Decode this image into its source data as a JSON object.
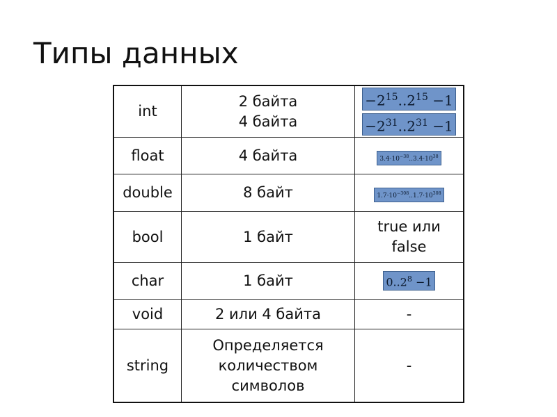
{
  "title": "Типы данных",
  "rows": [
    {
      "type": "int",
      "size": [
        "2 байта",
        "4 байта"
      ],
      "range": [
        [
          {
            "t": "−2"
          },
          {
            "s": "15"
          },
          {
            "t": "..2"
          },
          {
            "s": "15"
          },
          {
            "t": " −1"
          }
        ],
        [
          {
            "t": "−2"
          },
          {
            "s": "31"
          },
          {
            "t": "..2"
          },
          {
            "s": "31"
          },
          {
            "t": " −1"
          }
        ]
      ]
    },
    {
      "type": "float",
      "size": [
        "4 байта"
      ],
      "range": [
        [
          {
            "t": "3.4·10"
          },
          {
            "s": "−38"
          },
          {
            "t": "..3.4·10"
          },
          {
            "s": "38"
          }
        ]
      ]
    },
    {
      "type": "double",
      "size": [
        "8 байт"
      ],
      "range": [
        [
          {
            "t": "1.7·10"
          },
          {
            "s": "−308"
          },
          {
            "t": "..1.7·10"
          },
          {
            "s": "308"
          }
        ]
      ]
    },
    {
      "type": "bool",
      "size": [
        "1 байт"
      ],
      "range_text": [
        "true или",
        "false"
      ]
    },
    {
      "type": "char",
      "size": [
        "1 байт"
      ],
      "range": [
        [
          {
            "t": "0..2"
          },
          {
            "s": "8"
          },
          {
            "t": " −1"
          }
        ]
      ]
    },
    {
      "type": "void",
      "size": [
        "2 или 4 байта"
      ],
      "range_text": [
        "-"
      ]
    },
    {
      "type": "string",
      "size": [
        "Определяется",
        "количеством",
        "символов"
      ],
      "range_text": [
        "-"
      ]
    }
  ],
  "colors": {
    "formula_bg": "#6f94c9"
  }
}
